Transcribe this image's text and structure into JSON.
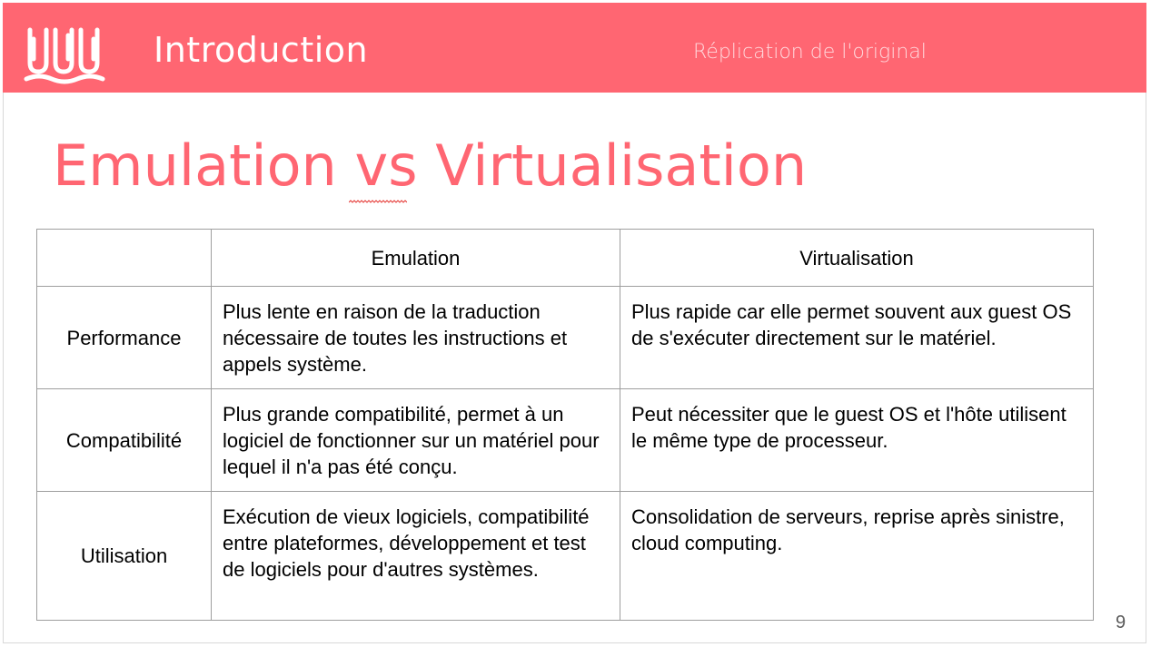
{
  "header": {
    "section_title": "Introduction",
    "subtitle": "Réplication de l'original",
    "logo": "squiggle-logo-icon",
    "band_color": "#ff6672"
  },
  "slide": {
    "title": "Emulation vs Virtualisation",
    "title_color": "#ff6672",
    "page_number": "9"
  },
  "table": {
    "columns": [
      "",
      "Emulation",
      "Virtualisation"
    ],
    "rows": [
      {
        "label": "Performance",
        "emulation": "Plus lente en raison de la traduction nécessaire de toutes les instructions et appels système.",
        "virtualisation": "Plus rapide car elle permet souvent aux guest OS de s'exécuter directement sur le matériel."
      },
      {
        "label": "Compatibilité",
        "emulation": "Plus grande compatibilité, permet à un logiciel de fonctionner sur un matériel pour lequel il n'a pas été conçu.",
        "virtualisation": "Peut nécessiter que le guest OS et l'hôte utilisent le même type de processeur."
      },
      {
        "label": "Utilisation",
        "emulation": "Exécution de vieux logiciels, compatibilité entre plateformes, développement et test de logiciels pour d'autres systèmes.",
        "virtualisation": "Consolidation de serveurs, reprise après sinistre, cloud computing."
      }
    ]
  }
}
